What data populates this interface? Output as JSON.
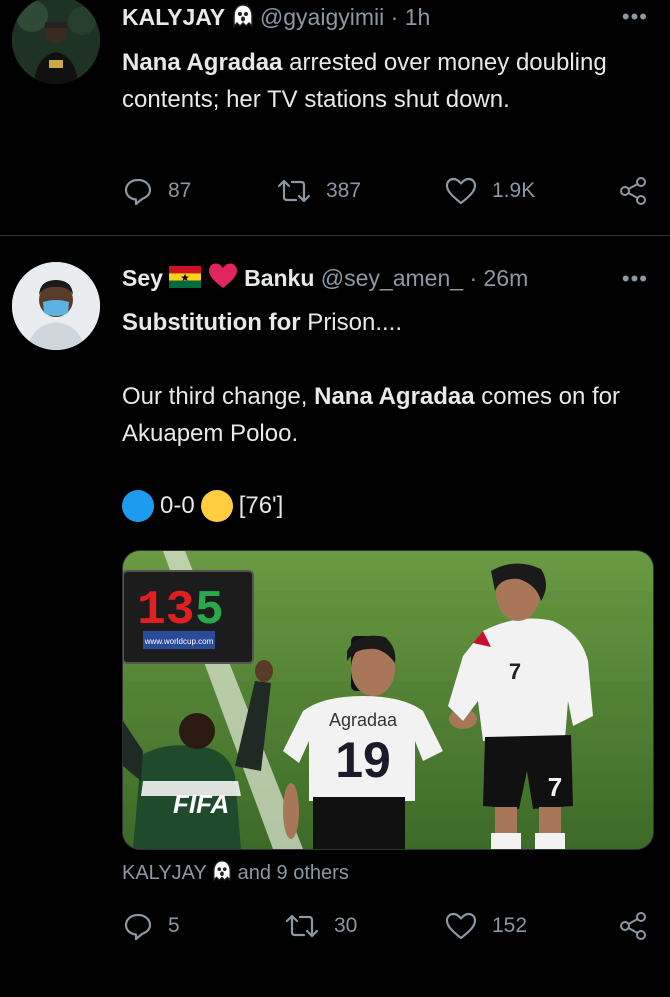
{
  "tweet1": {
    "name": "KALYJAY",
    "handle": "@gyaigyimii",
    "separator": "·",
    "time": "1h",
    "text_bold": "Nana Agradaa",
    "text_rest": " arrested over money doubling contents; her TV stations shut down.",
    "stats": {
      "replies": "87",
      "retweets": "387",
      "likes": "1.9K"
    },
    "more_label": "•••"
  },
  "tweet2": {
    "name_first": "Sey",
    "name_last": "Banku",
    "handle": "@sey_amen_",
    "separator": "·",
    "time": "26m",
    "line1_bold": "Substitution for",
    "line1_rest": " Prison....",
    "line2_pre": "Our third change, ",
    "line2_bold": "Nana Agradaa",
    "line2_rest": " comes on for Akuapem Poloo.",
    "score_text": "0-0",
    "minute": "[76']",
    "image": {
      "jersey_name": "Agradaa",
      "jersey_number": "19",
      "shorts_number": "7",
      "shirt_number": "7",
      "jacket_text": "FIFA",
      "board_digits": "13",
      "board_digits2": "5",
      "board_strip": "www.worldcup.com"
    },
    "social_name": "KALYJAY",
    "social_rest": "and 9 others",
    "stats": {
      "replies": "5",
      "retweets": "30",
      "likes": "152"
    },
    "more_label": "•••"
  },
  "colors": {
    "blue_circle": "#1d9bf0",
    "yellow_circle": "#ffcd3f",
    "ghana_red": "#ce1126",
    "ghana_gold": "#fcd116",
    "ghana_green": "#006b3f",
    "heart_red": "#e0245e",
    "muted": "#8b98a5"
  },
  "icons": [
    "ghost-emoji-icon",
    "ghana-flag-icon",
    "red-heart-icon",
    "reply-icon",
    "retweet-icon",
    "like-icon",
    "share-icon",
    "more-icon"
  ]
}
